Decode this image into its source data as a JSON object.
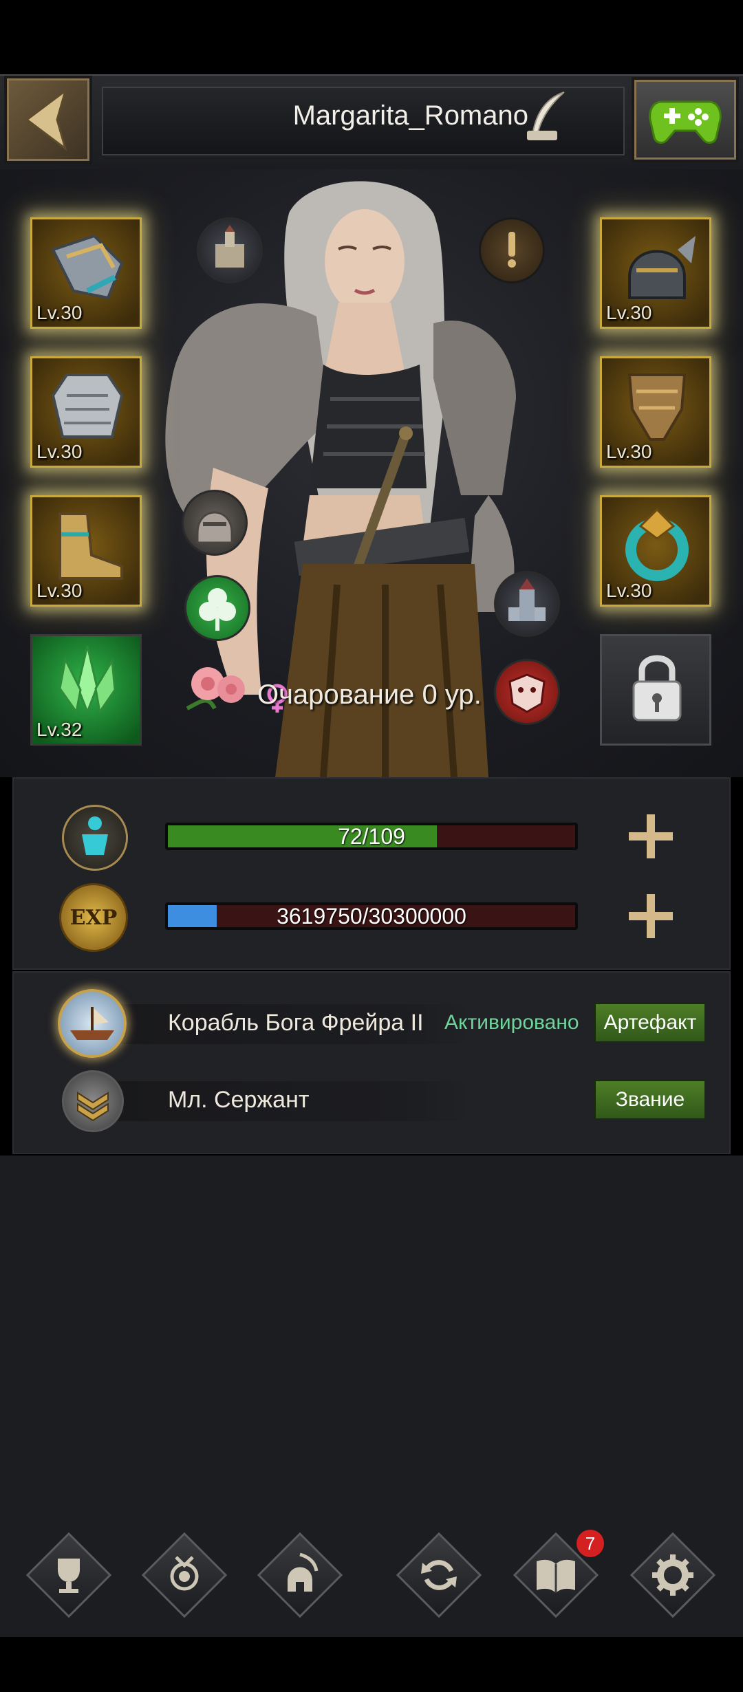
{
  "header": {
    "player_name": "Margarita_Romano",
    "back_icon": "chevron-left-icon",
    "edit_icon": "quill-icon",
    "games_icon": "gamepad-icon"
  },
  "equipment": {
    "left": [
      {
        "item": "gauntlet",
        "level": "Lv.30"
      },
      {
        "item": "chest-armor",
        "level": "Lv.30"
      },
      {
        "item": "boots",
        "level": "Lv.30"
      }
    ],
    "right": [
      {
        "item": "helmet",
        "level": "Lv.30"
      },
      {
        "item": "leg-armor",
        "level": "Lv.30"
      },
      {
        "item": "ring",
        "level": "Lv.30"
      }
    ],
    "crystal": {
      "level": "Lv.32"
    },
    "locked_slot": "padlock-icon"
  },
  "charm": {
    "text": "Очарование 0 ур."
  },
  "stats": {
    "stamina": {
      "value": 72,
      "max": 109,
      "text": "72/109",
      "color": "#3a8a22"
    },
    "exp": {
      "value": 3619750,
      "max": 30300000,
      "text": "3619750/30300000",
      "color": "#3d8de0",
      "icon_label": "EXP"
    }
  },
  "artifact": {
    "name": "Корабль Бога Фрейра II",
    "status": "Активировано",
    "button": "Артефакт",
    "status_color": "#6fd49a"
  },
  "rank": {
    "name": "Мл. Сержант",
    "button": "Звание"
  },
  "nav": {
    "items": [
      "trophy-icon",
      "medal-icon",
      "spartan-helmet-icon",
      "refresh-icon",
      "book-icon",
      "gear-icon"
    ],
    "badge": "7"
  }
}
